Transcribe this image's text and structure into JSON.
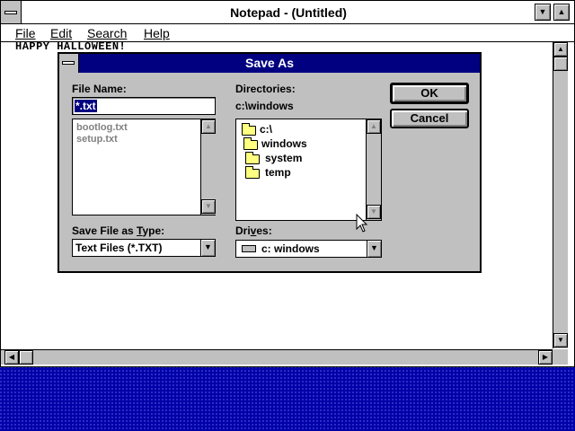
{
  "notepad": {
    "title": "Notepad - (Untitled)",
    "menu": [
      {
        "label": "File"
      },
      {
        "label": "Edit"
      },
      {
        "label": "Search"
      },
      {
        "label": "Help"
      }
    ],
    "document_text": "HAPPY HALLOWEEN!"
  },
  "dialog": {
    "title": "Save As",
    "file_name_label": "File Name:",
    "file_name_value": "*.txt",
    "files": [
      "bootlog.txt",
      "setup.txt"
    ],
    "directories_label": "Directories:",
    "current_dir": "c:\\windows",
    "dir_tree": [
      "c:\\",
      "windows",
      "system",
      "temp"
    ],
    "save_type_label": "Save File as Type:",
    "save_type_value": "Text Files (*.TXT)",
    "drives_label": "Drives:",
    "drive_value": "c: windows",
    "ok_label": "OK",
    "cancel_label": "Cancel"
  },
  "colors": {
    "desktop": "#0000a8",
    "active_title": "#000080",
    "face": "#c0c0c0",
    "folder": "#ffff80"
  }
}
